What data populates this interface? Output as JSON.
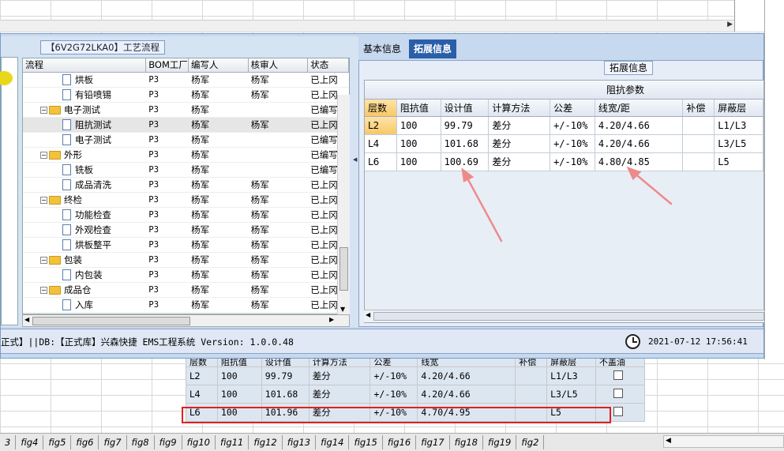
{
  "left_panel": {
    "process_tab": "【6V2G72LKA0】工艺流程",
    "columns": [
      "流程",
      "BOM工厂",
      "编写人",
      "核审人",
      "状态"
    ],
    "rows": [
      {
        "level": 2,
        "type": "doc",
        "name": "烘板",
        "bom": "P3",
        "author": "杨军",
        "reviewer": "杨军",
        "status": "已上冈"
      },
      {
        "level": 2,
        "type": "doc",
        "name": "有铅喷锡",
        "bom": "P3",
        "author": "杨军",
        "reviewer": "杨军",
        "status": "已上冈"
      },
      {
        "level": 1,
        "type": "folder",
        "name": "电子测试",
        "bom": "P3",
        "author": "杨军",
        "reviewer": "",
        "status": "已编写"
      },
      {
        "level": 2,
        "type": "doc",
        "name": "阻抗测试",
        "bom": "P3",
        "author": "杨军",
        "reviewer": "杨军",
        "status": "已上冈",
        "selected": true
      },
      {
        "level": 2,
        "type": "doc",
        "name": "电子测试",
        "bom": "P3",
        "author": "杨军",
        "reviewer": "",
        "status": "已编写"
      },
      {
        "level": 1,
        "type": "folder",
        "name": "外形",
        "bom": "P3",
        "author": "杨军",
        "reviewer": "",
        "status": "已编写"
      },
      {
        "level": 2,
        "type": "doc",
        "name": "铣板",
        "bom": "P3",
        "author": "杨军",
        "reviewer": "",
        "status": "已编写"
      },
      {
        "level": 2,
        "type": "doc",
        "name": "成品清洗",
        "bom": "P3",
        "author": "杨军",
        "reviewer": "杨军",
        "status": "已上冈"
      },
      {
        "level": 1,
        "type": "folder",
        "name": "终检",
        "bom": "P3",
        "author": "杨军",
        "reviewer": "杨军",
        "status": "已上冈"
      },
      {
        "level": 2,
        "type": "doc",
        "name": "功能检查",
        "bom": "P3",
        "author": "杨军",
        "reviewer": "杨军",
        "status": "已上冈"
      },
      {
        "level": 2,
        "type": "doc",
        "name": "外观检查",
        "bom": "P3",
        "author": "杨军",
        "reviewer": "杨军",
        "status": "已上冈"
      },
      {
        "level": 2,
        "type": "doc",
        "name": "烘板整平",
        "bom": "P3",
        "author": "杨军",
        "reviewer": "杨军",
        "status": "已上冈"
      },
      {
        "level": 1,
        "type": "folder",
        "name": "包装",
        "bom": "P3",
        "author": "杨军",
        "reviewer": "杨军",
        "status": "已上冈"
      },
      {
        "level": 2,
        "type": "doc",
        "name": "内包装",
        "bom": "P3",
        "author": "杨军",
        "reviewer": "杨军",
        "status": "已上冈"
      },
      {
        "level": 1,
        "type": "folder",
        "name": "成品仓",
        "bom": "P3",
        "author": "杨军",
        "reviewer": "杨军",
        "status": "已上冈"
      },
      {
        "level": 2,
        "type": "doc",
        "name": "入库",
        "bom": "P3",
        "author": "杨军",
        "reviewer": "杨军",
        "status": "已上冈"
      }
    ]
  },
  "right_panel": {
    "tabs": [
      {
        "label": "基本信息",
        "active": false
      },
      {
        "label": "拓展信息",
        "active": true
      }
    ],
    "section_title": "拓展信息",
    "group_header": "阻抗参数",
    "columns": [
      "层数",
      "阻抗值",
      "设计值",
      "计算方法",
      "公差",
      "线宽/距",
      "补偿",
      "屏蔽层"
    ],
    "rows": [
      [
        "L2",
        "100",
        "99.79",
        "差分",
        "+/-10%",
        "4.20/4.66",
        "",
        "L1/L3"
      ],
      [
        "L4",
        "100",
        "101.68",
        "差分",
        "+/-10%",
        "4.20/4.66",
        "",
        "L3/L5"
      ],
      [
        "L6",
        "100",
        "100.69",
        "差分",
        "+/-10%",
        "4.80/4.85",
        "",
        "L5"
      ]
    ]
  },
  "status_bar": {
    "text": "正式】||DB:【正式库】兴森快捷 EMS工程系统 Version: 1.0.0.48",
    "time": "2021-07-12 17:56:41"
  },
  "excel_table": {
    "columns": [
      "层数",
      "阻抗值",
      "设计值",
      "计算方法",
      "公差",
      "线宽",
      "补偿",
      "屏蔽层",
      "不盖油"
    ],
    "rows": [
      [
        "L2",
        "100",
        "99.79",
        "差分",
        "+/-10%",
        "4.20/4.66",
        "",
        "L1/L3"
      ],
      [
        "L4",
        "100",
        "101.68",
        "差分",
        "+/-10%",
        "4.20/4.66",
        "",
        "L3/L5"
      ],
      [
        "L6",
        "100",
        "101.96",
        "差分",
        "+/-10%",
        "4.70/4.95",
        "",
        "L5"
      ]
    ]
  },
  "sheet_tabs": [
    "3",
    "fig4",
    "fig5",
    "fig6",
    "fig7",
    "fig8",
    "fig9",
    "fig10",
    "fig11",
    "fig12",
    "fig13",
    "fig14",
    "fig15",
    "fig16",
    "fig17",
    "fig18",
    "fig19",
    "fig2"
  ],
  "colors": {
    "accent": "#2a5ea8",
    "highlight": "#e02020",
    "annotation_arrow": "#ef8a8a"
  }
}
